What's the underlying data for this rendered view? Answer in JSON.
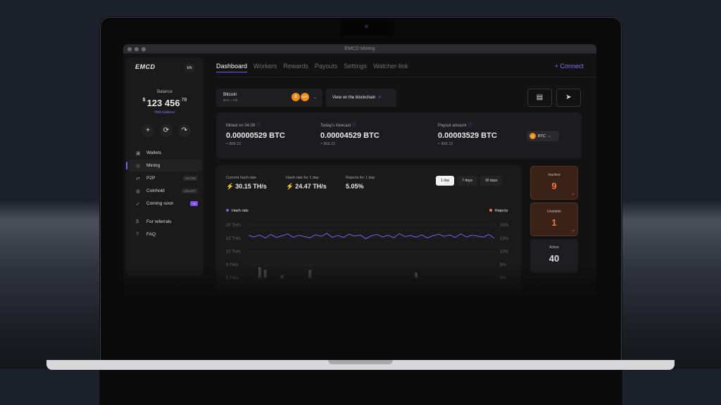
{
  "window_title": "EMCD Mining",
  "sidebar": {
    "logo": "EMCD",
    "lang": "EN",
    "balance_label": "Balance",
    "balance_currency": "$",
    "balance_int": "123 456",
    "balance_dec": ".78",
    "hide_balance": "Hide balance",
    "items": [
      {
        "label": "Wallets",
        "icon": "wallet-icon",
        "tag": ""
      },
      {
        "label": "Mining",
        "icon": "mining-icon",
        "tag": ""
      },
      {
        "label": "P2P",
        "icon": "swap-icon",
        "tag": "0% FEE"
      },
      {
        "label": "Coinhold",
        "icon": "coins-icon",
        "tag": "14% APY"
      },
      {
        "label": "Coming soon",
        "icon": "rocket-icon",
        "tag": "+4"
      },
      {
        "label": "For referrals",
        "icon": "dollar-icon",
        "tag": ""
      },
      {
        "label": "FAQ",
        "icon": "question-icon",
        "tag": ""
      }
    ]
  },
  "header": {
    "tabs": [
      "Dashboard",
      "Workers",
      "Rewards",
      "Payouts",
      "Settings",
      "Watcher-link"
    ],
    "connect": "+ Connect"
  },
  "coin_selector": {
    "name": "Bitcoin",
    "sub": "BTC + FB",
    "badge1": "₿",
    "badge2": "APP"
  },
  "view_blockchain": "View on the blockchain",
  "stats": {
    "mined_label": "Mined on 04.09",
    "mined_value": "0.00000529 BTC",
    "mined_usd": "≈ $68.22",
    "forecast_label": "Today's forecast",
    "forecast_value": "0.00004529 BTC",
    "forecast_usd": "≈ $68.22",
    "payout_label": "Payout amount",
    "payout_value": "0.00003529 BTC",
    "payout_usd": "≈ $68.22",
    "payout_coin": "BTC"
  },
  "hashrate": {
    "current_label": "Current hash rate",
    "current_value": "30.15 TH/s",
    "day_label": "Hash rate for 1 day",
    "day_value": "24.47 TH/s",
    "rejects_label": "Rejects for 1 day",
    "rejects_value": "5.05%",
    "ranges": [
      "1 day",
      "7 days",
      "30 days"
    ],
    "legend_hash": "Hash rate",
    "legend_rejects": "Rejects"
  },
  "workers": {
    "inactive_label": "Inactive",
    "inactive_value": "9",
    "unstable_label": "Unstable",
    "unstable_value": "1",
    "active_label": "Active",
    "active_value": "40"
  },
  "chart_data": {
    "type": "line",
    "title": "",
    "y_left_ticks": [
      "20 TH/s",
      "15 TH/s",
      "10 TH/s",
      "5 TH/s",
      "0 TH/s"
    ],
    "y_right_ticks": [
      "20%",
      "15%",
      "10%",
      "5%",
      "0%"
    ],
    "ylim_left": [
      0,
      20
    ],
    "ylim_right": [
      0,
      20
    ],
    "series": [
      {
        "name": "Hash rate",
        "color": "#7c5cf0",
        "values": [
          16,
          15.5,
          16.2,
          15.1,
          16.4,
          15.3,
          15.9,
          16.6,
          15.4,
          16.1,
          15.6,
          15.2,
          16.3,
          15.7,
          16.8,
          15.4,
          16.0,
          15.3,
          16.5,
          15.8,
          16.2,
          14.8,
          15.9,
          16.4,
          15.5,
          16.1,
          15.2,
          16.7,
          15.6,
          16.0,
          15.4,
          16.3,
          15.1,
          15.9,
          16.5,
          15.7,
          16.2,
          15.3,
          16.6,
          15.5,
          16.1,
          15.8,
          15.4,
          16.4,
          15.0
        ]
      },
      {
        "name": "Rejects",
        "color": "#f07a3a",
        "values": [
          0,
          0,
          4,
          3,
          0,
          0,
          1,
          0,
          0,
          0,
          0,
          3,
          0,
          0,
          0,
          0,
          0,
          0,
          0,
          0,
          0,
          0,
          0,
          0,
          0,
          0,
          0,
          0,
          0,
          0,
          2,
          0,
          0,
          0,
          0,
          0,
          0,
          0,
          0,
          0,
          0,
          0,
          0,
          0,
          0
        ]
      }
    ]
  }
}
